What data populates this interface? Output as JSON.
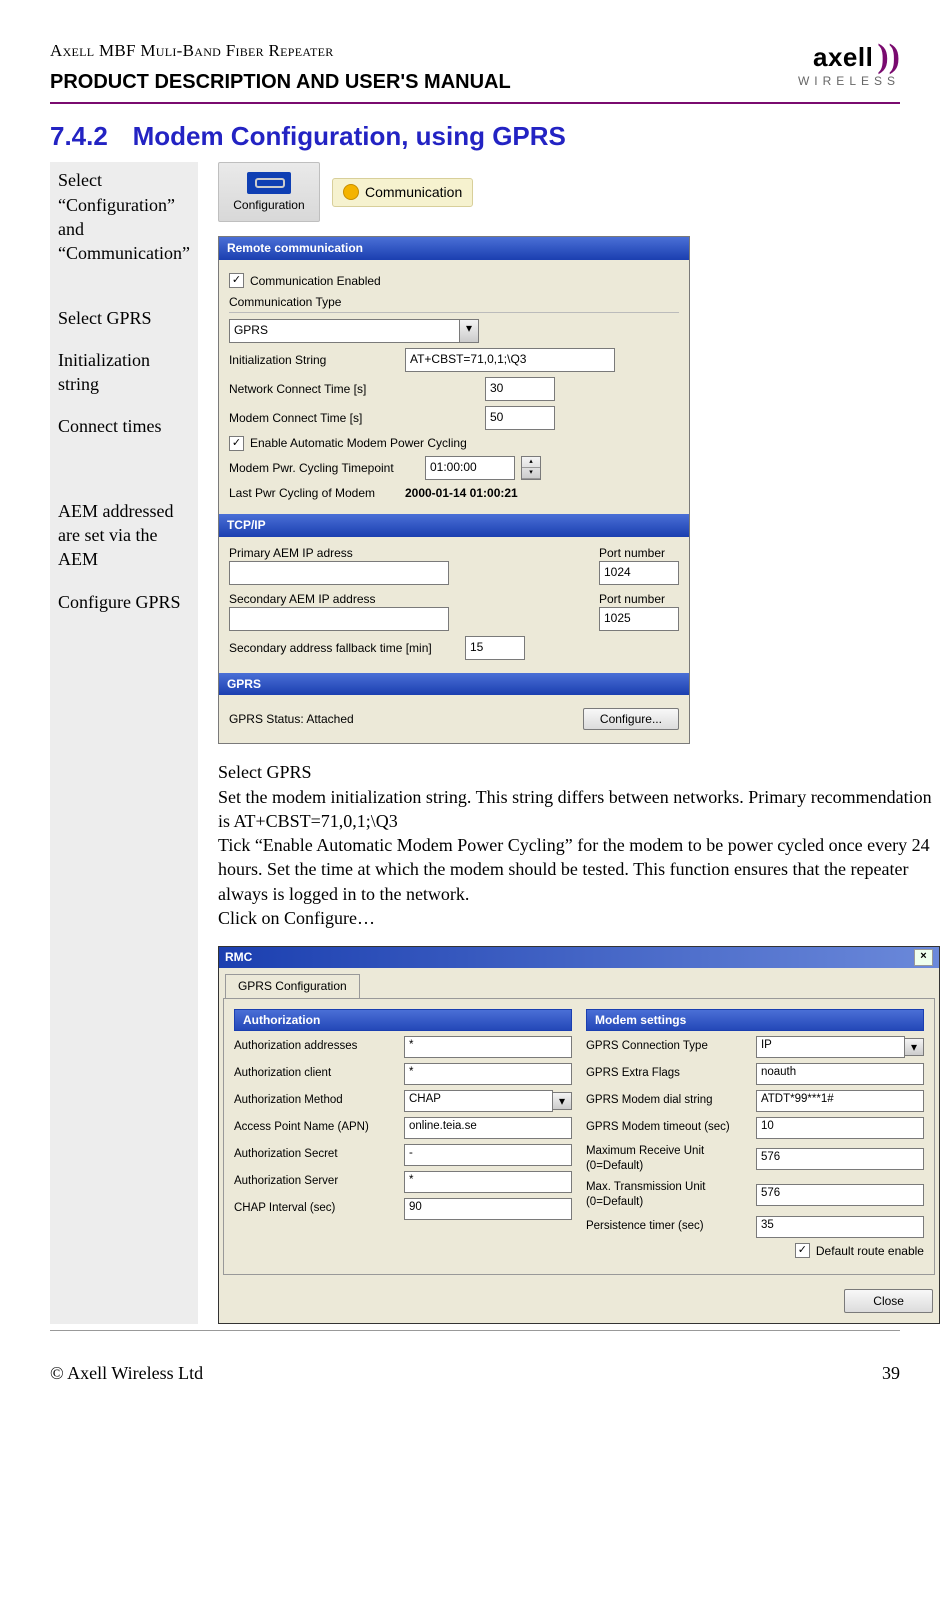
{
  "doc": {
    "product": "Axell MBF Muli-Band Fiber Repeater",
    "subtitle": "PRODUCT DESCRIPTION AND USER'S MANUAL",
    "brand": "axell",
    "brand_sub": "WIRELESS"
  },
  "section": {
    "num": "7.4.2",
    "title": "Modem Configuration, using GPRS"
  },
  "sidebar": {
    "step1": "Select “Configuration” and “Communication”",
    "step2": "Select GPRS",
    "step3": "Initialization string",
    "step4": "Connect times",
    "step5": "AEM addressed are set via the AEM",
    "step6": "Configure GPRS"
  },
  "icons": {
    "config_label": "Configuration",
    "comm_label": "Communication"
  },
  "remote": {
    "title": "Remote communication",
    "comm_enabled": "Communication Enabled",
    "comm_type_label": "Communication Type",
    "comm_type_value": "GPRS",
    "init_label": "Initialization String",
    "init_value": "AT+CBST=71,0,1;\\Q3",
    "net_time_label": "Network Connect Time [s]",
    "net_time_value": "30",
    "modem_time_label": "Modem Connect Time [s]",
    "modem_time_value": "50",
    "enable_cycle": "Enable Automatic Modem Power Cycling",
    "cycle_tp_label": "Modem Pwr. Cycling Timepoint",
    "cycle_tp_value": "01:00:00",
    "last_cycle_label": "Last Pwr Cycling of Modem",
    "last_cycle_value": "2000-01-14    01:00:21",
    "tcpip": "TCP/IP",
    "prim_ip_label": "Primary AEM IP adress",
    "prim_port_label": "Port number",
    "prim_port_value": "1024",
    "sec_ip_label": "Secondary AEM IP address",
    "sec_port_label": "Port number",
    "sec_port_value": "1025",
    "fallback_label": "Secondary address fallback time [min]",
    "fallback_value": "15",
    "gprs_bar": "GPRS",
    "status_label": "GPRS Status: Attached",
    "configure_btn": "Configure..."
  },
  "instructions": {
    "l1": "Select GPRS",
    "l2": "Set the modem initialization string. This string differs between networks. Primary recommendation is AT+CBST=71,0,1;\\Q3",
    "l3": "Tick “Enable Automatic Modem Power Cycling” for the modem to be power cycled once every 24 hours. Set the time at which the modem should be tested. This function ensures that the repeater always is logged in to the network.",
    "l4": "Click on Configure…"
  },
  "dlg": {
    "rmc": "RMC",
    "tab": "GPRS Configuration",
    "auth_h": "Authorization",
    "modem_h": "Modem settings",
    "auth": {
      "addresses_l": "Authorization addresses",
      "addresses_v": "*",
      "client_l": "Authorization client",
      "client_v": "*",
      "method_l": "Authorization Method",
      "method_v": "CHAP",
      "apn_l": "Access Point Name (APN)",
      "apn_v": "online.teia.se",
      "secret_l": "Authorization Secret",
      "secret_v": "-",
      "server_l": "Authorization Server",
      "server_v": "*",
      "chap_l": "CHAP Interval (sec)",
      "chap_v": "90"
    },
    "modem": {
      "conn_l": "GPRS Connection Type",
      "conn_v": "IP",
      "flags_l": "GPRS Extra Flags",
      "flags_v": "noauth",
      "dial_l": "GPRS Modem dial string",
      "dial_v": "ATDT*99***1#",
      "timeout_l": "GPRS Modem timeout (sec)",
      "timeout_v": "10",
      "mru_l": "Maximum Receive Unit (0=Default)",
      "mru_v": "576",
      "mtu_l": "Max. Transmission Unit (0=Default)",
      "mtu_v": "576",
      "persist_l": "Persistence timer (sec)",
      "persist_v": "35",
      "droute_l": "Default route enable"
    },
    "close_btn": "Close"
  },
  "footer": {
    "copyright": "© Axell Wireless Ltd",
    "page": "39"
  }
}
